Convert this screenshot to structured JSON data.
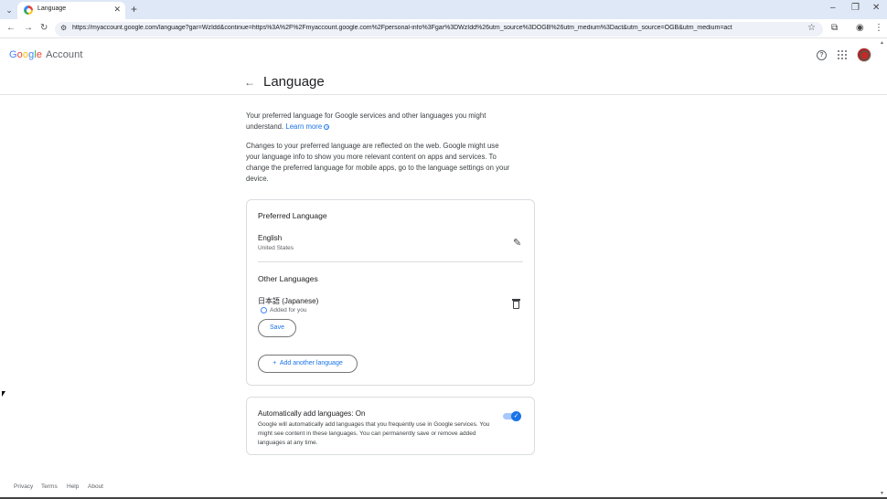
{
  "browser": {
    "tab_title": "Language",
    "new_tab": "+",
    "url": "https://myaccount.google.com/language?gar=WzIdd&continue=https%3A%2F%2Fmyaccount.google.com%2Fpersonal-info%3Fgar%3DWzIdd%26utm_source%3DOGB%26utm_medium%3Dact&utm_source=OGB&utm_medium=act"
  },
  "header": {
    "logo_letters": [
      "G",
      "o",
      "o",
      "g",
      "l",
      "e"
    ],
    "logo_suffix": "Account",
    "help": "?"
  },
  "page": {
    "title": "Language",
    "intro": "Your preferred language for Google services and other languages you might understand.",
    "learn_more": "Learn more",
    "intro2": "Changes to your preferred language are reflected on the web. Google might use your language info to show you more relevant content on apps and services. To change the preferred language for mobile apps, go to the language settings on your device."
  },
  "preferred": {
    "title": "Preferred Language",
    "language": "English",
    "region": "United States"
  },
  "other": {
    "title": "Other Languages",
    "language": "日本語 (Japanese)",
    "added_note": "Added for you",
    "save_label": "Save",
    "add_label": "Add another language",
    "add_plus": "+"
  },
  "auto_add": {
    "title": "Automatically add languages: On",
    "description": "Google will automatically add languages that you frequently use in Google services. You might see content in these languages. You can permanently save or remove added languages at any time.",
    "enabled": true
  },
  "footer": {
    "privacy": "Privacy",
    "terms": "Terms",
    "help": "Help",
    "about": "About"
  },
  "colors": {
    "accent": "#1a73e8",
    "tabbar": "#dfe8f6"
  }
}
